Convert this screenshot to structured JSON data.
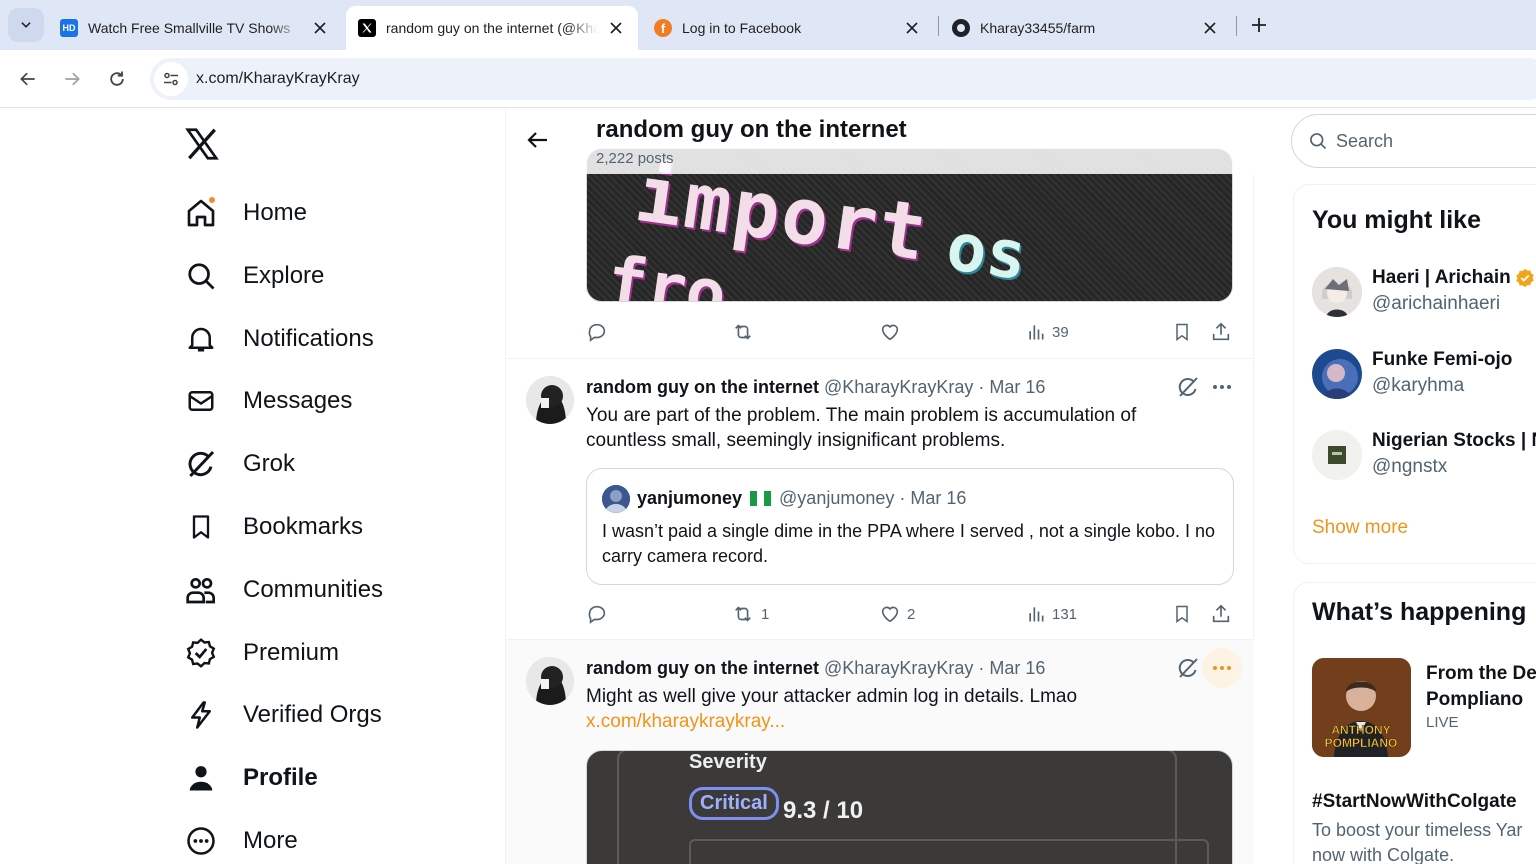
{
  "browser": {
    "tabs": [
      {
        "title": "Watch Free Smallville TV Shows",
        "favicon": "hd-icon"
      },
      {
        "title": "random guy on the internet (@KharayKrayKray) / X",
        "favicon": "x-icon"
      },
      {
        "title": "Log in to Facebook",
        "favicon": "facebook-icon"
      },
      {
        "title": "Kharay33455/farm",
        "favicon": "github-icon"
      }
    ],
    "active_tab": 1,
    "url": "x.com/KharayKrayKray",
    "accent": "#dfe7f6"
  },
  "nav": {
    "items": [
      {
        "label": "Home",
        "icon": "home-icon"
      },
      {
        "label": "Explore",
        "icon": "search-icon"
      },
      {
        "label": "Notifications",
        "icon": "bell-icon"
      },
      {
        "label": "Messages",
        "icon": "mail-icon"
      },
      {
        "label": "Grok",
        "icon": "grok-icon"
      },
      {
        "label": "Bookmarks",
        "icon": "bookmark-icon"
      },
      {
        "label": "Communities",
        "icon": "communities-icon"
      },
      {
        "label": "Premium",
        "icon": "premium-icon"
      },
      {
        "label": "Verified Orgs",
        "icon": "lightning-icon"
      },
      {
        "label": "Profile",
        "icon": "person-icon"
      },
      {
        "label": "More",
        "icon": "more-circle-icon"
      }
    ]
  },
  "header": {
    "name": "random guy on the internet",
    "posts": "2,222 posts"
  },
  "top_media": {
    "text_lines": [
      "import",
      "os",
      "fro"
    ]
  },
  "top_actions": {
    "views": "39"
  },
  "posts": [
    {
      "name": "random guy on the internet",
      "meta": "@KharayKrayKray · Mar 16",
      "text": "You are part of the problem. The main problem is accumulation of countless small, seemingly insignificant problems.",
      "quote": {
        "name": "yanjumoney",
        "meta": "@yanjumoney · Mar 16",
        "text": "I wasn’t paid a single dime in the PPA where I served , not a single kobo. I no carry camera record."
      },
      "reposts": "1",
      "likes": "2",
      "views": "131"
    },
    {
      "name": "random guy on the internet",
      "meta": "@KharayKrayKray · Mar 16",
      "text": "Might as well give your attacker admin log in details. Lmao",
      "link": "x.com/kharaykraykray...",
      "media": {
        "label1": "Severity",
        "badge": "Critical",
        "score": "9.3 / 10"
      }
    }
  ],
  "sidebar": {
    "search_placeholder": "Search",
    "who_to_follow_title": "You might like",
    "suggestions": [
      {
        "name": "Haeri | Arichain",
        "handle": "@arichainhaeri",
        "verified": true
      },
      {
        "name": "Funke Femi-ojo",
        "handle": "@karyhma"
      },
      {
        "name": "Nigerian Stocks | N",
        "handle": "@ngnstx"
      }
    ],
    "show_more": "Show more",
    "happening_title": "What’s happening",
    "trend": {
      "title": "From the De Pompliano",
      "title_line1": "From the De",
      "title_line2": "Pompliano",
      "status": "LIVE",
      "image_text1": "ANTHONY",
      "image_text2": "POMPLIANO"
    },
    "hashtag": {
      "tag": "#StartNowWithColgate",
      "desc_line1": "To boost your timeless Yar",
      "desc_line2": "now with Colgate."
    }
  },
  "colors": {
    "accent_orange": "#f29318",
    "text_secondary": "#536471"
  }
}
